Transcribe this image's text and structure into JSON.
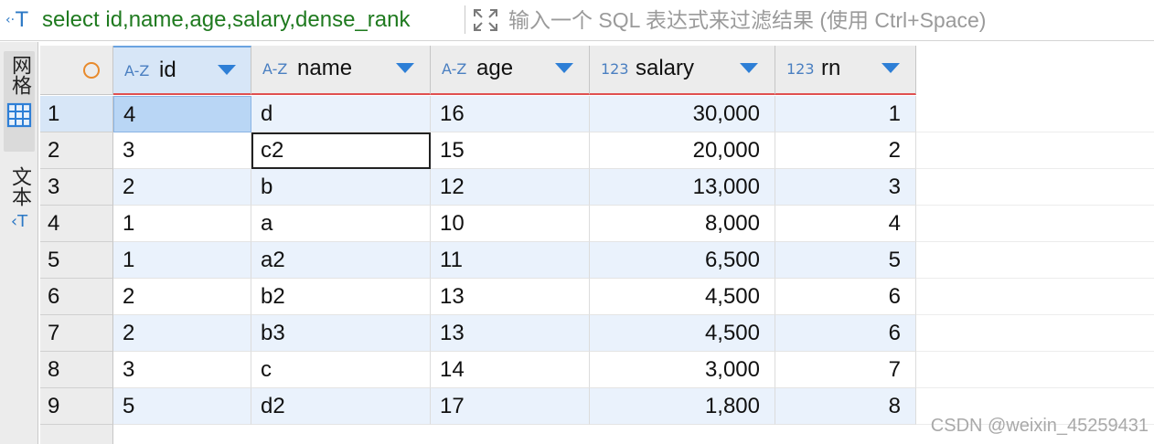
{
  "filter_bar": {
    "sql_icon_symbol": "T",
    "query": "select id,name,age,salary,dense_rank",
    "placeholder": "输入一个 SQL 表达式来过滤结果 (使用 Ctrl+Space)"
  },
  "side_panel": {
    "grid_label": "网格",
    "text_label": "文本"
  },
  "columns": [
    {
      "type": "A-Z",
      "name": "id"
    },
    {
      "type": "A-Z",
      "name": "name"
    },
    {
      "type": "A-Z",
      "name": "age"
    },
    {
      "type": "123",
      "name": "salary"
    },
    {
      "type": "123",
      "name": "rn"
    }
  ],
  "rows": [
    {
      "num": "1",
      "id": "4",
      "name": "d",
      "age": "16",
      "salary": "30,000",
      "rn": "1"
    },
    {
      "num": "2",
      "id": "3",
      "name": "c2",
      "age": "15",
      "salary": "20,000",
      "rn": "2"
    },
    {
      "num": "3",
      "id": "2",
      "name": "b",
      "age": "12",
      "salary": "13,000",
      "rn": "3"
    },
    {
      "num": "4",
      "id": "1",
      "name": "a",
      "age": "10",
      "salary": "8,000",
      "rn": "4"
    },
    {
      "num": "5",
      "id": "1",
      "name": "a2",
      "age": "11",
      "salary": "6,500",
      "rn": "5"
    },
    {
      "num": "6",
      "id": "2",
      "name": "b2",
      "age": "13",
      "salary": "4,500",
      "rn": "6"
    },
    {
      "num": "7",
      "id": "2",
      "name": "b3",
      "age": "13",
      "salary": "4,500",
      "rn": "6"
    },
    {
      "num": "8",
      "id": "3",
      "name": "c",
      "age": "14",
      "salary": "3,000",
      "rn": "7"
    },
    {
      "num": "9",
      "id": "5",
      "name": "d2",
      "age": "17",
      "salary": "1,800",
      "rn": "8"
    }
  ],
  "watermark": "CSDN @weixin_45259431",
  "colors": {
    "accent": "#2e7fd6",
    "query_text": "#1f7a1f",
    "header_underline": "#e05050",
    "alt_row": "#eaf2fc",
    "selected_cell": "#b9d6f5"
  }
}
